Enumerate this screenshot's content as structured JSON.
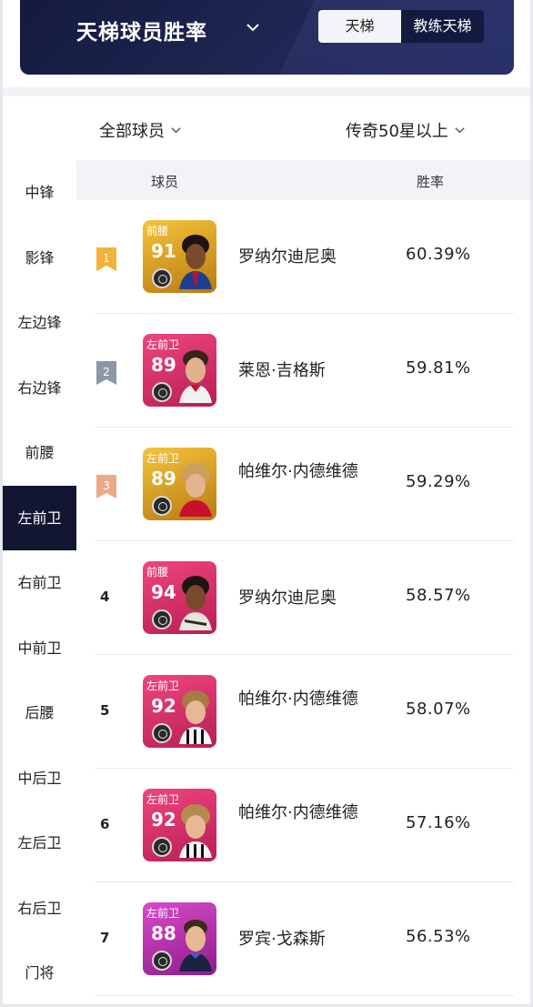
{
  "header": {
    "title": "天梯球员胜率",
    "tabs": [
      {
        "label": "天梯",
        "active": true
      },
      {
        "label": "教练天梯",
        "active": false
      }
    ]
  },
  "filters": {
    "players": "全部球员",
    "tier": "传奇50星以上"
  },
  "sidenav": {
    "items": [
      "中锋",
      "影锋",
      "左边锋",
      "右边锋",
      "前腰",
      "左前卫",
      "右前卫",
      "中前卫",
      "后腰",
      "中后卫",
      "左后卫",
      "右后卫",
      "门将"
    ],
    "active": "左前卫"
  },
  "table": {
    "columns": {
      "player": "球员",
      "rate": "胜率"
    },
    "rows": [
      {
        "rank": "1",
        "position": "前腰",
        "rating": "91",
        "name": "罗纳尔迪尼奥",
        "rate": "60.39%",
        "card_color": "#e0a21b",
        "rank_color": "#f3b23a"
      },
      {
        "rank": "2",
        "position": "左前卫",
        "rating": "89",
        "name": "莱恩·吉格斯",
        "rate": "59.81%",
        "card_color": "#e23a73",
        "rank_color": "#8e97a8"
      },
      {
        "rank": "3",
        "position": "左前卫",
        "rating": "89",
        "name": "帕维尔·内德维德",
        "rate": "59.29%",
        "card_color": "#e0a21b",
        "rank_color": "#eba98a"
      },
      {
        "rank": "4",
        "position": "前腰",
        "rating": "94",
        "name": "罗纳尔迪尼奥",
        "rate": "58.57%",
        "card_color": "#e23a73",
        "rank_color": ""
      },
      {
        "rank": "5",
        "position": "左前卫",
        "rating": "92",
        "name": "帕维尔·内德维德",
        "rate": "58.07%",
        "card_color": "#e23a73",
        "rank_color": ""
      },
      {
        "rank": "6",
        "position": "左前卫",
        "rating": "92",
        "name": "帕维尔·内德维德",
        "rate": "57.16%",
        "card_color": "#e23a73",
        "rank_color": ""
      },
      {
        "rank": "7",
        "position": "左前卫",
        "rating": "88",
        "name": "罗宾·戈森斯",
        "rate": "56.53%",
        "card_color": "#c235b5",
        "rank_color": ""
      }
    ]
  }
}
